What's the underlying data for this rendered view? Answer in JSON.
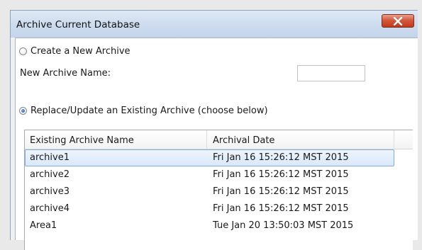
{
  "window": {
    "title": "Archive Current Database",
    "close_label": "X"
  },
  "form": {
    "create_option_label": "Create a New Archive",
    "create_option_checked": false,
    "name_label": "New Archive Name:",
    "name_value": "",
    "replace_option_label": "Replace/Update an Existing Archive (choose below)",
    "replace_option_checked": true
  },
  "table": {
    "columns": [
      "Existing Archive Name",
      "Archival Date"
    ],
    "rows": [
      {
        "name": "archive1",
        "date": "Fri Jan 16 15:26:12 MST 2015",
        "selected": true
      },
      {
        "name": "archive2",
        "date": "Fri Jan 16 15:26:12 MST 2015",
        "selected": false
      },
      {
        "name": "archive3",
        "date": "Fri Jan 16 15:26:12 MST 2015",
        "selected": false
      },
      {
        "name": "archive4",
        "date": "Fri Jan 16 15:26:12 MST 2015",
        "selected": false
      },
      {
        "name": "Area1",
        "date": "Tue Jan 20 13:50:03 MST 2015",
        "selected": false
      }
    ]
  },
  "colors": {
    "titlebar": "#cddbee",
    "close_button": "#c83c20",
    "selection": "#d9e8fb"
  }
}
